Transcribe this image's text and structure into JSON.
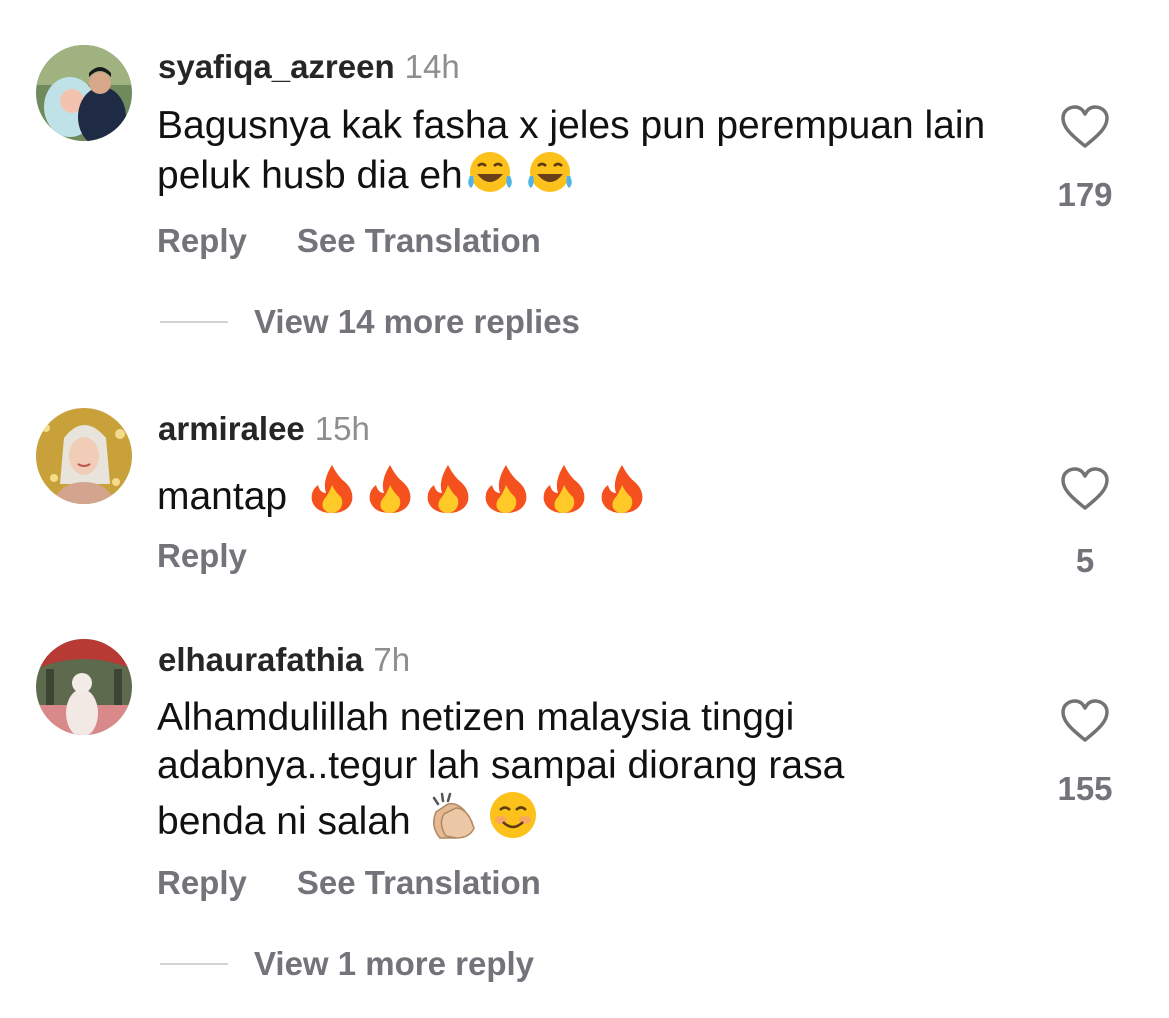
{
  "comments": [
    {
      "username": "syafiqa_azreen",
      "time": "14h",
      "text": "Bagusnya kak fasha x jeles pun perempuan lain peluk husb dia eh",
      "emojis": [
        "laughing-tears-emoji",
        "laughing-tears-emoji"
      ],
      "like_count": "179",
      "reply_label": "Reply",
      "translation_label": "See Translation",
      "view_more_label": "View 14 more replies"
    },
    {
      "username": "armiralee",
      "time": "15h",
      "text": "mantap",
      "emojis": [
        "fire-emoji",
        "fire-emoji",
        "fire-emoji",
        "fire-emoji",
        "fire-emoji",
        "fire-emoji"
      ],
      "like_count": "5",
      "reply_label": "Reply"
    },
    {
      "username": "elhaurafathia",
      "time": "7h",
      "text": "Alhamdulillah netizen malaysia tinggi adabnya..tegur lah sampai diorang rasa benda ni salah",
      "emojis": [
        "clapping-hands-emoji",
        "smiling-face-emoji"
      ],
      "like_count": "155",
      "reply_label": "Reply",
      "translation_label": "See Translation",
      "view_more_label": "View 1 more reply"
    }
  ],
  "icons": {
    "like": "heart-outline-icon"
  },
  "colors": {
    "username": "#262626",
    "timestamp": "#8e8e8e",
    "secondary": "#73737a",
    "divider": "#d4d4d8"
  }
}
